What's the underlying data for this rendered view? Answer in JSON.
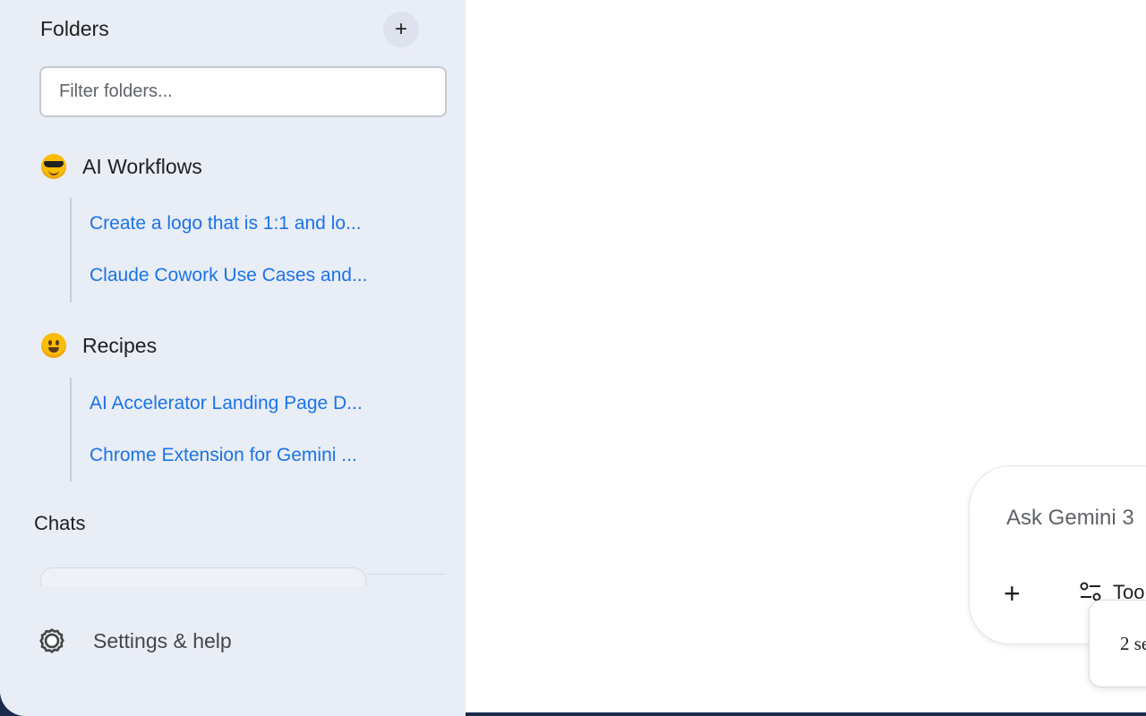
{
  "sidebar": {
    "folders_title": "Folders",
    "add_folder_label": "+",
    "filter_placeholder": "Filter folders...",
    "folders": [
      {
        "name": "AI Workflows",
        "emoji": "smiling-face-with-sunglasses",
        "chats": [
          "Create a logo that is 1:1 and lo...",
          "Claude Cowork Use Cases and..."
        ]
      },
      {
        "name": "Recipes",
        "emoji": "grinning-face",
        "chats": [
          "AI Accelerator Landing Page D...",
          "Chrome Extension for Gemini ..."
        ]
      }
    ],
    "chats_title": "Chats",
    "settings_label": "Settings & help"
  },
  "prompt": {
    "placeholder": "Ask Gemini 3",
    "add_label": "+",
    "tools_label": "Too"
  },
  "tooltip": {
    "text": "2 se"
  },
  "colors": {
    "sidebar_bg": "#e9edf6",
    "link": "#1a73e8",
    "text": "#1f1f1f"
  }
}
